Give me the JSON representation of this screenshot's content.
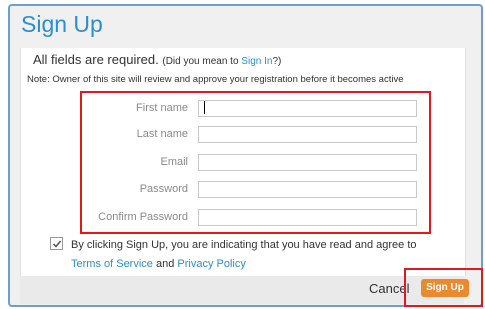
{
  "dialog": {
    "title": "Sign Up"
  },
  "notice": {
    "required_text": "All fields are required.",
    "hint_prefix": "(Did you mean to ",
    "hint_link": "Sign In",
    "hint_suffix": "?)",
    "note": "Note: Owner of this site will review and approve your registration before it becomes active"
  },
  "form": {
    "fields": [
      {
        "label": "First name",
        "value": "",
        "placeholder": ""
      },
      {
        "label": "Last name",
        "value": "",
        "placeholder": ""
      },
      {
        "label": "Email",
        "value": "",
        "placeholder": ""
      },
      {
        "label": "Password",
        "value": "",
        "placeholder": ""
      },
      {
        "label": "Confirm Password",
        "value": "",
        "placeholder": ""
      }
    ]
  },
  "agreement": {
    "checked": true,
    "text_prefix": "By clicking Sign Up, you are indicating that you have read and agree to ",
    "terms_link": "Terms of Service",
    "conjunction": " and ",
    "privacy_link": "Privacy Policy"
  },
  "footer": {
    "cancel_label": "Cancel",
    "signup_label": "Sign Up"
  },
  "colors": {
    "title": "#2a8fd0",
    "link": "#2a8fd0",
    "signup_button": "#e98a2d",
    "highlight": "#e0191c",
    "dialog_border": "#6f9fc6"
  },
  "icons": {
    "checkbox": "checkmark-icon"
  }
}
